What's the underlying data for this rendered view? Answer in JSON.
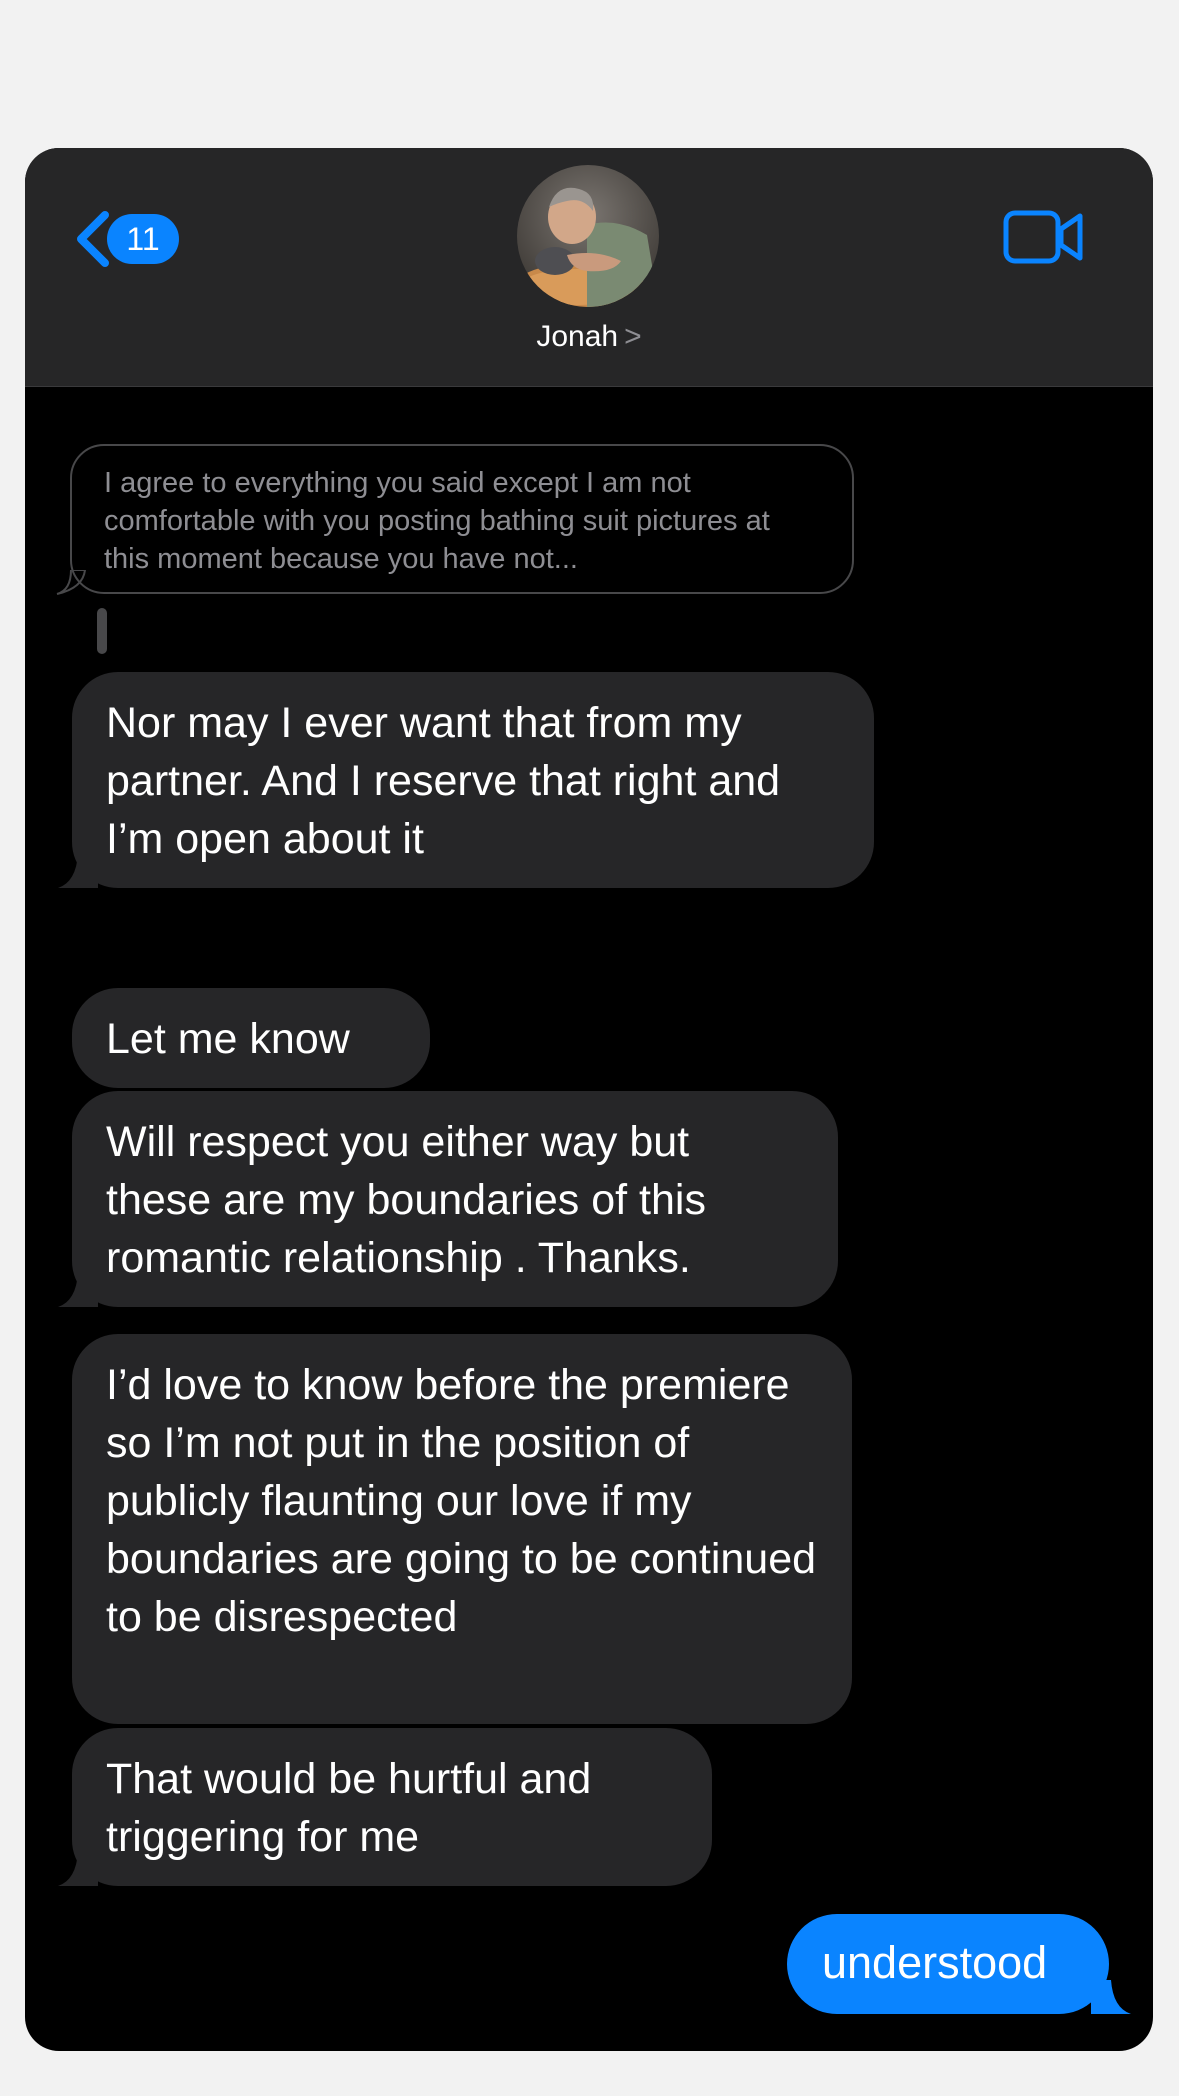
{
  "header": {
    "back_badge": "11",
    "contact_name": "Jonah",
    "contact_chevron": ">",
    "back_icon": "chevron-left-icon",
    "video_icon": "video-camera-icon"
  },
  "colors": {
    "accent": "#0a84ff",
    "received_bubble": "#262628",
    "background": "#000000"
  },
  "messages": {
    "quoted_reply": "I agree to everything you said except I am not comfortable with you posting bathing suit pictures at this moment because you have not...",
    "received": [
      "Nor may I ever want that from my partner. And I reserve that right and I’m open about it",
      "Let me know",
      "Will respect you either way but these are my boundaries of this romantic relationship . Thanks.",
      "I’d love to know before the premiere so I’m not put in the position of publicly flaunting our love if my boundaries are going to be continued to be disrespected",
      "That would be hurtful and triggering for me"
    ],
    "sent": [
      "understood"
    ]
  }
}
